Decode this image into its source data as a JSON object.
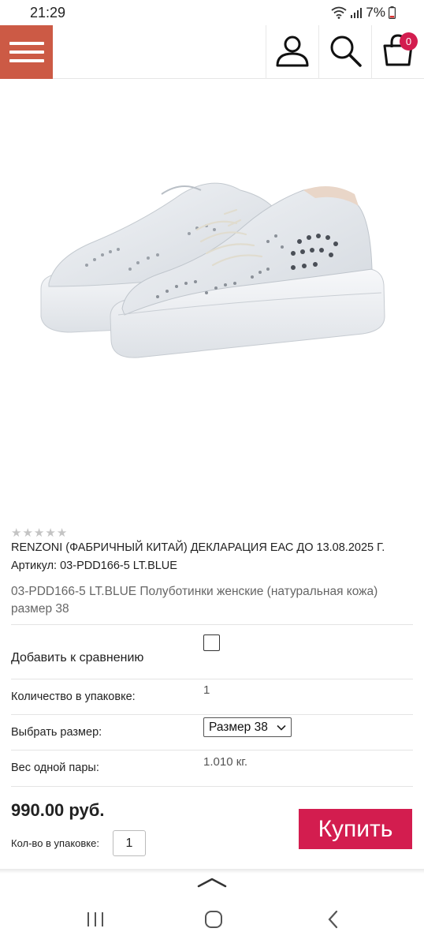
{
  "status_bar": {
    "time": "21:29",
    "battery": "7%"
  },
  "header": {
    "cart_count": "0",
    "icons": [
      "menu-icon",
      "user-icon",
      "search-icon",
      "cart-icon"
    ]
  },
  "product": {
    "rating": 0,
    "rating_max": 5,
    "brand_line": "RENZONI (ФАБРИЧНЫЙ КИТАЙ) ДЕКЛАРАЦИЯ ЕАС ДО 13.08.2025 Г.",
    "sku_line": "Артикул: 03-PDD166-5 LT.BLUE",
    "title": "03-PDD166-5 LT.BLUE Полуботинки женские (натуральная кожа) размер 38",
    "compare_label": "Добавить к сравнению",
    "pack_qty_label": "Количество в упаковке:",
    "pack_qty_value": "1",
    "size_label": "Выбрать размер:",
    "size_selected": "Размер 38",
    "weight_label": "Вес одной пары:",
    "weight_value": "1.010 кг.",
    "price": "990.00 руб.",
    "buy_label": "Купить",
    "qty_input_label": "Кол-во в упаковке:",
    "qty_input_value": "1"
  },
  "colors": {
    "menu_bg": "#cc5a45",
    "accent": "#d31d4f"
  }
}
